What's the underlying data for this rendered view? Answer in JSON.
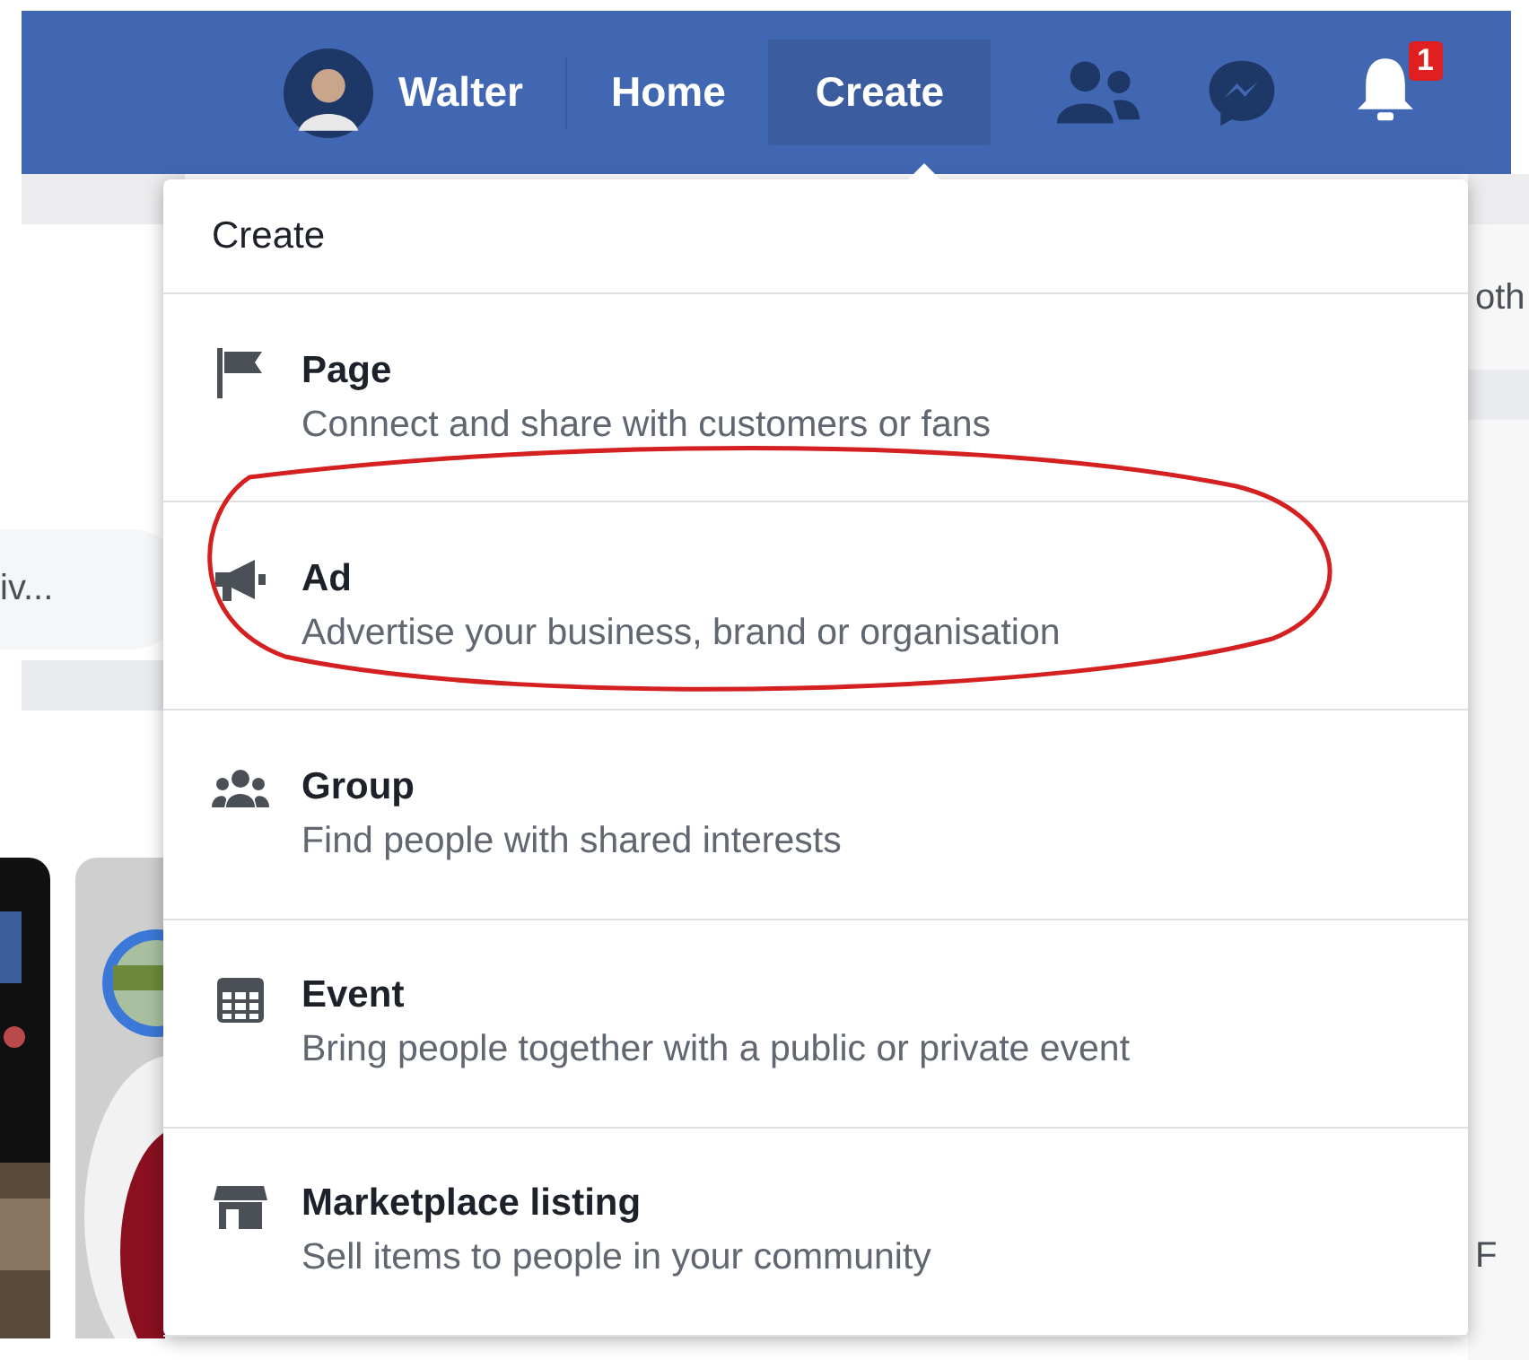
{
  "header": {
    "profile_name": "Walter",
    "nav": [
      {
        "label": "Home",
        "selected": false
      },
      {
        "label": "Create",
        "selected": true
      }
    ],
    "notification_count": "1"
  },
  "background": {
    "left_text": "iv...",
    "right_texts": [
      "oth",
      "F"
    ]
  },
  "menu": {
    "title": "Create",
    "items": [
      {
        "kind": "page",
        "title": "Page",
        "description": "Connect and share with customers or fans",
        "highlighted": false
      },
      {
        "kind": "ad",
        "title": "Ad",
        "description": "Advertise your business, brand or organisation",
        "highlighted": true
      },
      {
        "kind": "group",
        "title": "Group",
        "description": "Find people with shared interests",
        "highlighted": false
      },
      {
        "kind": "event",
        "title": "Event",
        "description": "Bring people together with a public or private event",
        "highlighted": false
      },
      {
        "kind": "listing",
        "title": "Marketplace listing",
        "description": "Sell items to people in your community",
        "highlighted": false
      }
    ]
  }
}
